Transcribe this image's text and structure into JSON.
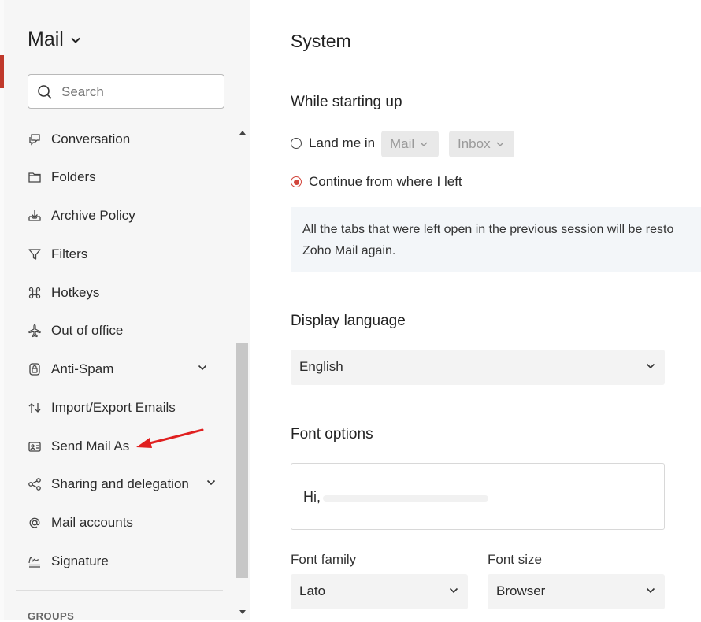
{
  "sidebar": {
    "title": "Mail",
    "search_placeholder": "Search",
    "items": [
      {
        "label": "Conversation",
        "icon": "conversation-icon"
      },
      {
        "label": "Folders",
        "icon": "folder-icon"
      },
      {
        "label": "Archive Policy",
        "icon": "archive-icon"
      },
      {
        "label": "Filters",
        "icon": "filter-icon"
      },
      {
        "label": "Hotkeys",
        "icon": "command-key-icon"
      },
      {
        "label": "Out of office",
        "icon": "airplane-icon"
      },
      {
        "label": "Anti-Spam",
        "icon": "shield-icon"
      },
      {
        "label": "Import/Export Emails",
        "icon": "import-export-icon"
      },
      {
        "label": "Send Mail As",
        "icon": "id-card-icon"
      },
      {
        "label": "Sharing and delegation",
        "icon": "share-icon"
      },
      {
        "label": "Mail accounts",
        "icon": "at-sign-icon"
      },
      {
        "label": "Signature",
        "icon": "signature-icon"
      }
    ],
    "section_heading": "GROUPS"
  },
  "main": {
    "title": "System",
    "startup": {
      "heading": "While starting up",
      "option_land": "Land me in",
      "land_app": "Mail",
      "land_folder": "Inbox",
      "option_continue": "Continue from where I left",
      "selected": "continue",
      "info_line1": "All the tabs that were left open in the previous session will be resto",
      "info_line2": "Zoho Mail again."
    },
    "language": {
      "heading": "Display language",
      "value": "English"
    },
    "font": {
      "heading": "Font options",
      "preview_text": "Hi,",
      "family_label": "Font family",
      "family_value": "Lato",
      "size_label": "Font size",
      "size_value": "Browser"
    }
  },
  "colors": {
    "accent": "#d2453b",
    "annotation_arrow": "#e02020"
  }
}
